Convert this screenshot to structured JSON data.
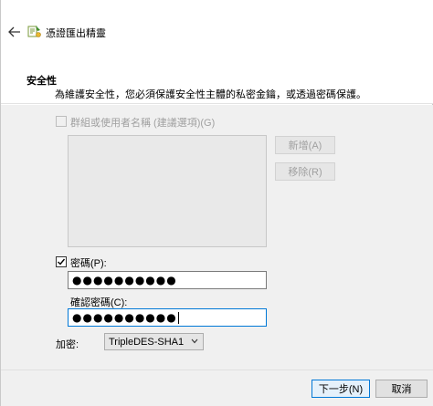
{
  "window": {
    "title": "憑證匯出精靈"
  },
  "header": {
    "section_title": "安全性",
    "section_description": "為維護安全性，您必須保護安全性主體的私密金鑰，或透過密碼保護。"
  },
  "groups": {
    "checkbox_label": "群組或使用者名稱 (建議選項)(G)",
    "checked": false,
    "enabled": false,
    "add_button": "新增(A)",
    "remove_button": "移除(R)"
  },
  "password": {
    "checkbox_label": "密碼(P):",
    "checked": true,
    "value": "●●●●●●●●●●",
    "confirm_label": "確認密碼(C):",
    "confirm_value": "●●●●●●●●●●"
  },
  "encryption": {
    "label": "加密:",
    "selected": "TripleDES-SHA1"
  },
  "footer": {
    "next_button": "下一步(N)",
    "cancel_button": "取消"
  },
  "colors": {
    "focus_border": "#0078d7",
    "panel_bg": "#f0f0f0",
    "disabled_text": "#a0a0a0"
  },
  "icons": {
    "back": "back-arrow-icon",
    "app": "certificate-wizard-icon",
    "checkmark": "checkmark-icon",
    "dropdown": "chevron-down-icon"
  }
}
